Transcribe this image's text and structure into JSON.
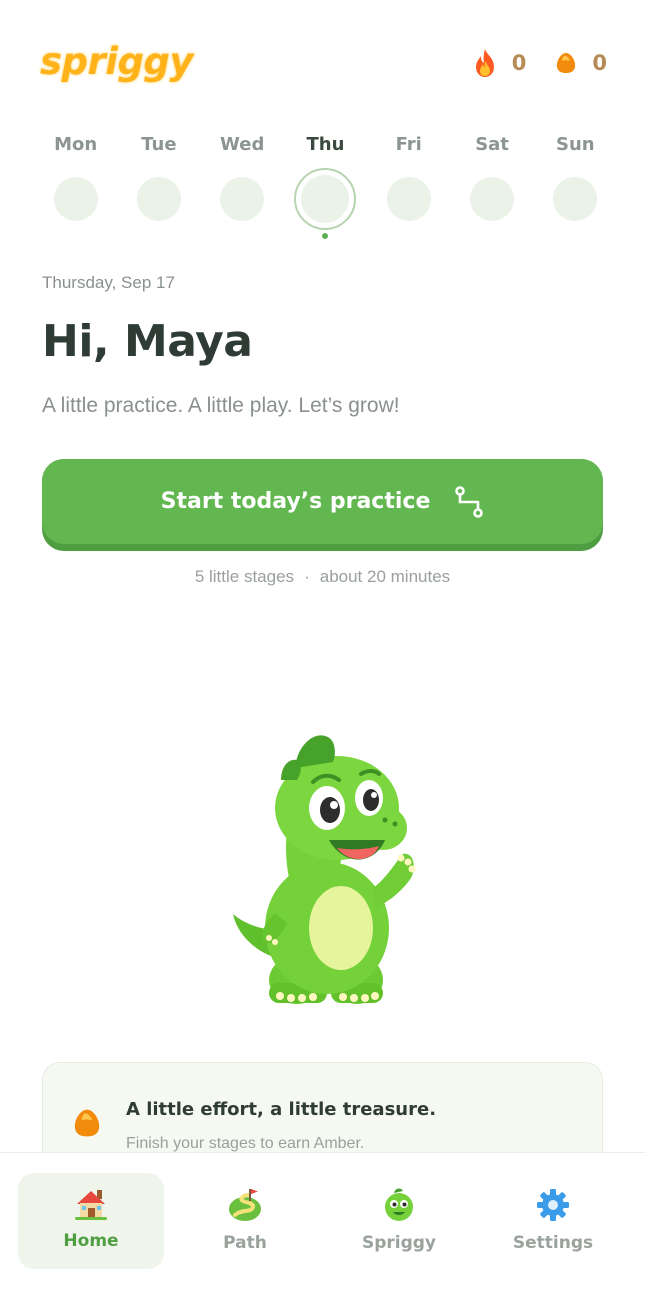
{
  "app": {
    "logo_text": "spriggy"
  },
  "counters": {
    "streak": {
      "icon": "flame-icon",
      "value": "0"
    },
    "amber": {
      "icon": "amber-gem-icon",
      "value": "0"
    }
  },
  "week": {
    "days": [
      {
        "label": "Mon",
        "today": false
      },
      {
        "label": "Tue",
        "today": false
      },
      {
        "label": "Wed",
        "today": false
      },
      {
        "label": "Thu",
        "today": true
      },
      {
        "label": "Fri",
        "today": false
      },
      {
        "label": "Sat",
        "today": false
      },
      {
        "label": "Sun",
        "today": false
      }
    ]
  },
  "greeting": {
    "date": "Thursday, Sep 17",
    "title": "Hi, Maya",
    "tagline": "A little practice. A little play. Let’s grow!"
  },
  "cta": {
    "label": "Start today’s practice",
    "icon": "path-route-icon",
    "stages": "5 little stages",
    "separator": "·",
    "duration": "about 20 minutes"
  },
  "reward": {
    "icon": "amber-gem-icon",
    "title": "A little effort, a little treasure.",
    "subtitle": "Finish your stages to earn Amber."
  },
  "nav": {
    "items": [
      {
        "label": "Home",
        "icon": "house-icon",
        "active": true
      },
      {
        "label": "Path",
        "icon": "path-map-icon",
        "active": false
      },
      {
        "label": "Spriggy",
        "icon": "dino-face-icon",
        "active": false
      },
      {
        "label": "Settings",
        "icon": "gear-icon",
        "active": false
      }
    ]
  },
  "colors": {
    "primary_green": "#63b751",
    "primary_green_dark": "#4e9e41",
    "logo_orange": "#ffb21a",
    "amber_text": "#b58a54"
  }
}
